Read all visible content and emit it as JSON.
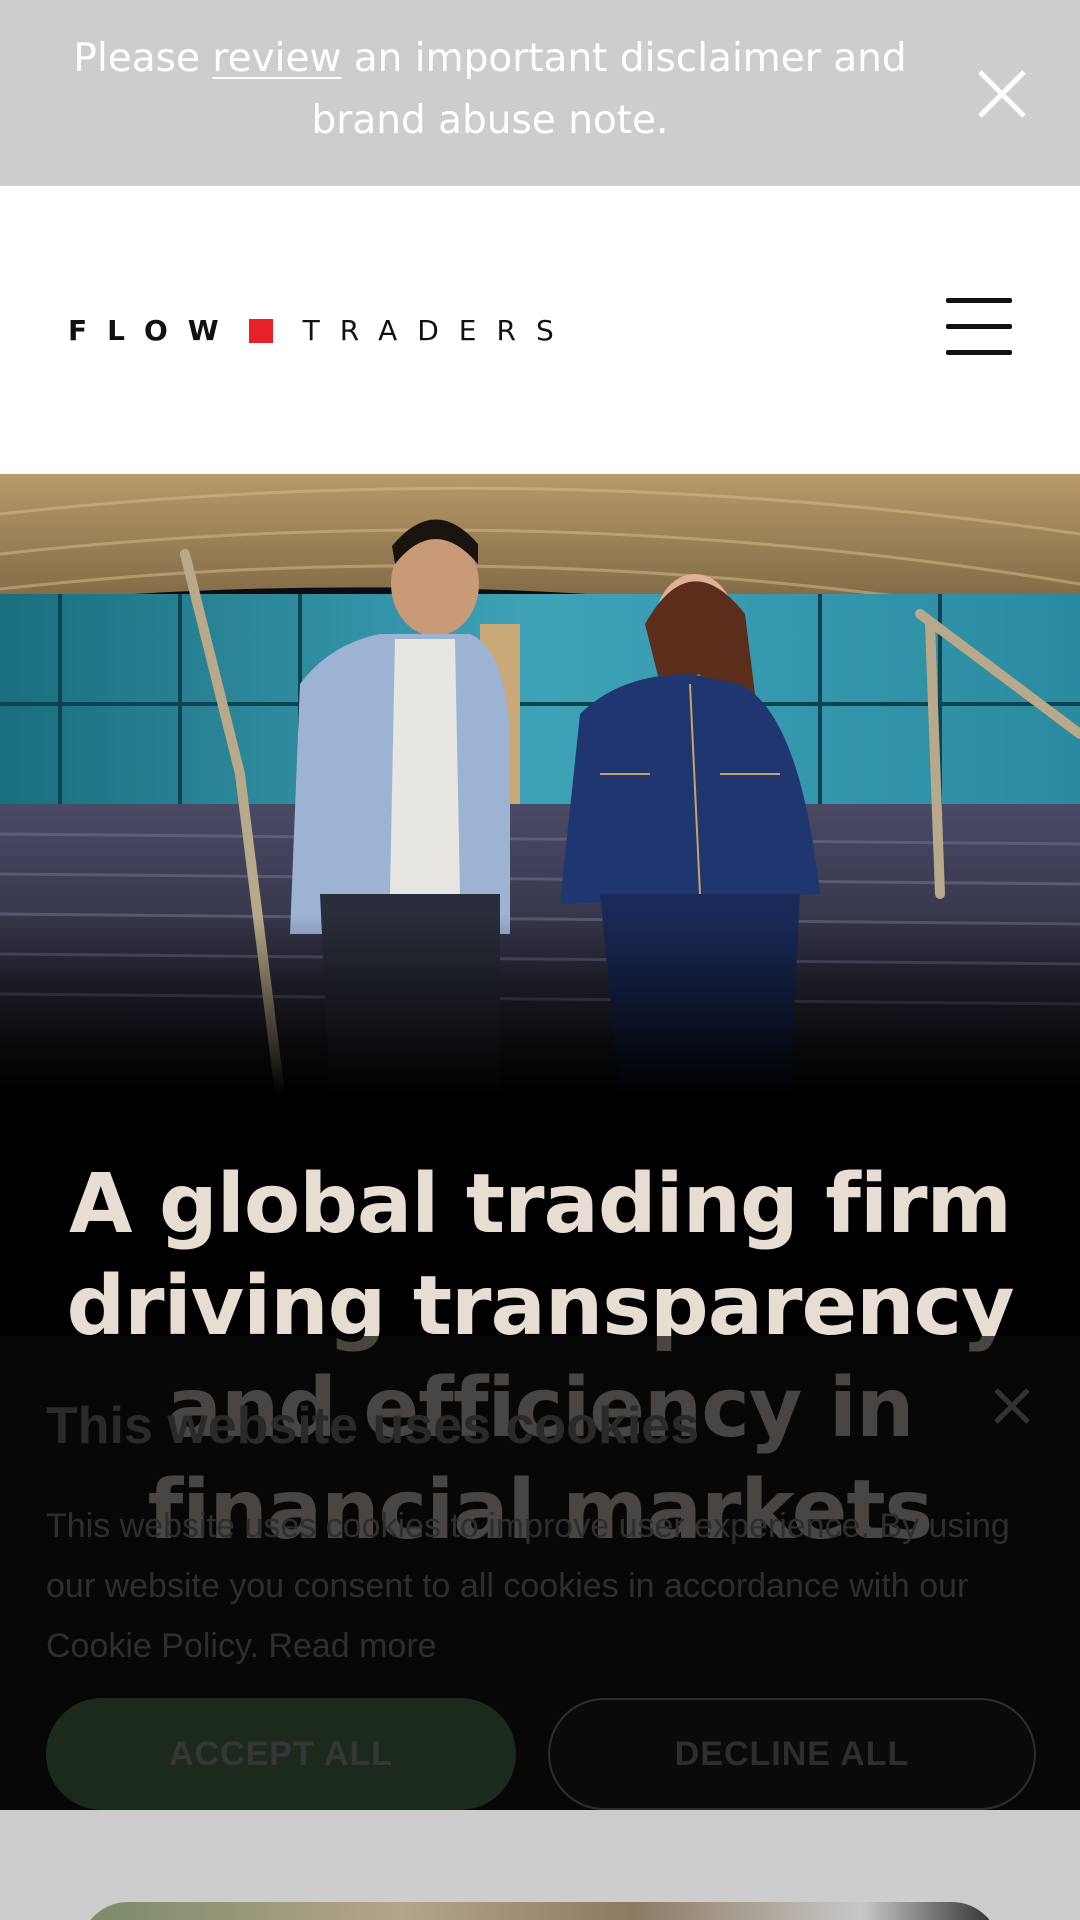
{
  "disclaimer": {
    "text_before": "Please ",
    "link_label": "review",
    "text_after": " an important disclaimer and brand abuse note.",
    "close_icon": "close-icon"
  },
  "header": {
    "logo": {
      "word_one": "FLOW",
      "word_two": "TRADERS"
    },
    "menu_icon": "hamburger-menu-icon"
  },
  "hero": {
    "image_description": "photo",
    "heading": "A global trading firm driving transparency and efficiency in financial markets"
  },
  "cookie_banner": {
    "title": "This website uses cookies",
    "body": "This website uses cookies to improve user experience. By using our website you consent to all cookies in accordance with our Cookie Policy.",
    "read_more": "Read more",
    "accept_label": "ACCEPT ALL",
    "decline_label": "DECLINE ALL",
    "close_icon": "close-icon"
  },
  "colors": {
    "brand_red": "#e8202a",
    "disclaimer_bg": "#cdcdcd",
    "hero_heading": "#e8ddd2",
    "accept_button": "#1c2a1e"
  }
}
